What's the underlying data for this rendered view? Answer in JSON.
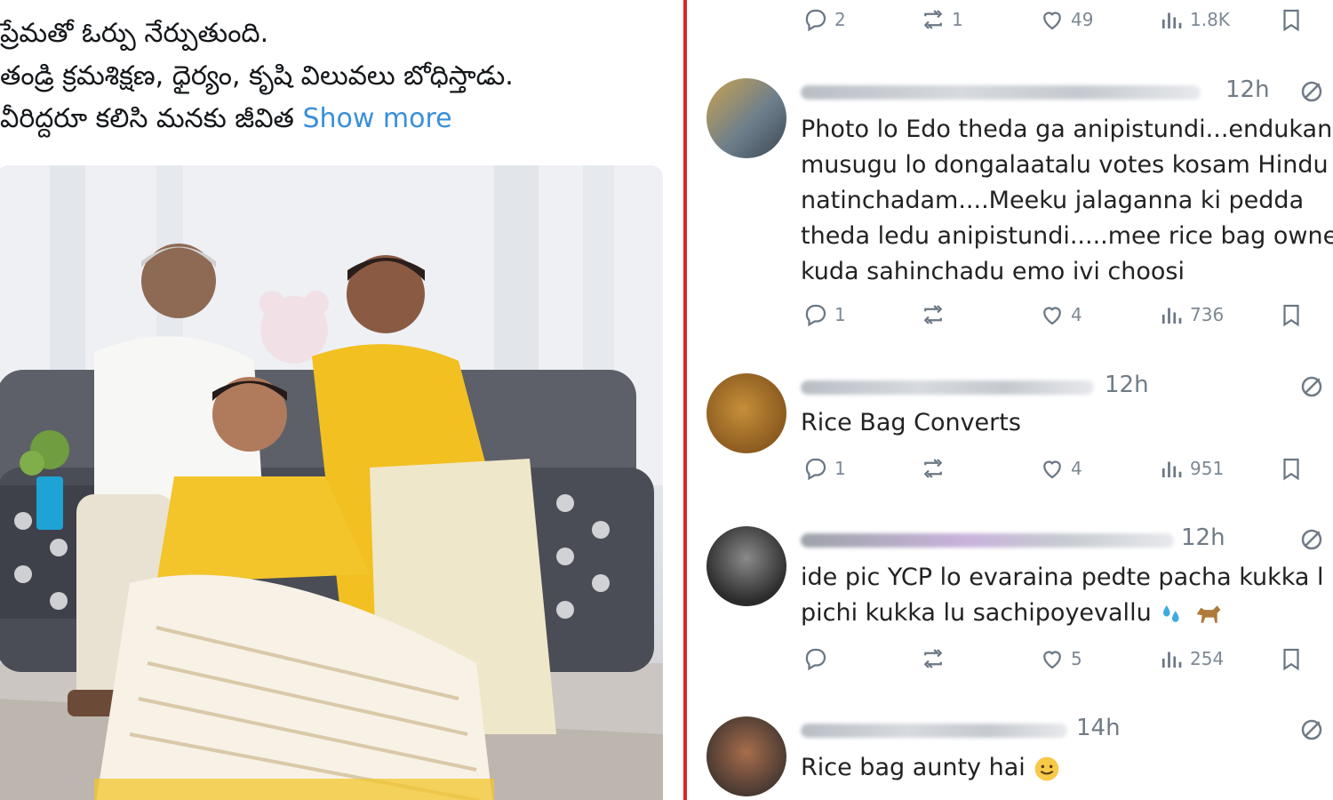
{
  "tweet": {
    "lines": [
      "ప్రేమతో ఓర్పు నేర్పుతుంది.",
      "తండ్రి క్రమశిక్షణ, ధైర్యం, కృషి విలువలు బోధిస్తాడు.",
      "వీరిద్దరూ కలిసి మనకు జీవిత"
    ],
    "show_more": "Show more"
  },
  "top_actions": {
    "replies": "2",
    "retweets": "1",
    "likes": "49",
    "views": "1.8K"
  },
  "replies": [
    {
      "time": "12h",
      "lines": [
        "Photo lo Edo theda ga anipistundi...endukan",
        "musugu lo dongalaatalu votes kosam Hindu",
        "natinchadam....Meeku jalaganna ki pedda",
        "theda ledu anipistundi.....mee rice bag owne",
        "kuda sahinchadu emo ivi choosi"
      ],
      "actions": {
        "replies": "1",
        "retweets": "",
        "likes": "4",
        "views": "736"
      }
    },
    {
      "time": "12h",
      "lines": [
        "Rice Bag Converts"
      ],
      "actions": {
        "replies": "1",
        "retweets": "",
        "likes": "4",
        "views": "951"
      }
    },
    {
      "time": "12h",
      "lines": [
        "ide pic YCP lo evaraina pedte pacha kukka l",
        "pichi kukka lu sachipoyevallu"
      ],
      "actions": {
        "replies": "",
        "retweets": "",
        "likes": "5",
        "views": "254"
      }
    },
    {
      "time": "14h",
      "lines": [
        "Rice bag aunty hai"
      ]
    }
  ],
  "icons": {
    "reply": "speech-bubble-icon",
    "retweet": "retweet-icon",
    "like": "heart-icon",
    "views": "bar-chart-icon",
    "bookmark": "bookmark-icon",
    "grok": "grok-icon"
  },
  "colors": {
    "divider": "#d8262b",
    "link": "#3a8fd9",
    "muted": "#707b86"
  }
}
